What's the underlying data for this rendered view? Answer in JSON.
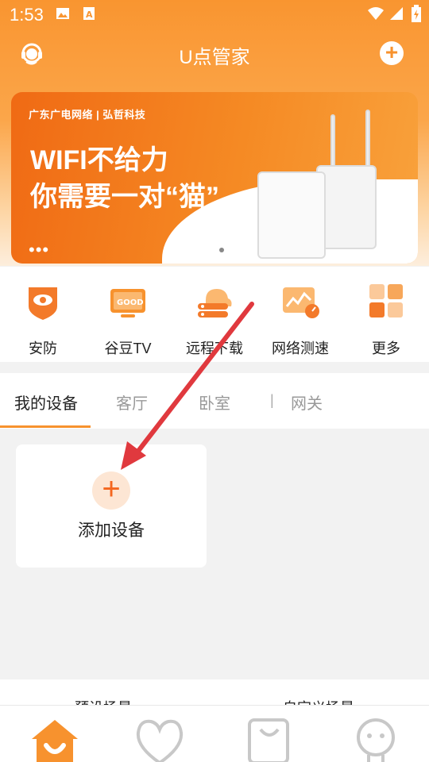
{
  "status": {
    "time": "1:53"
  },
  "header": {
    "title": "U点管家"
  },
  "banner": {
    "brand": "广东广电网络 | 弘哲科技",
    "headline1": "WIFI不给力",
    "headline2": "你需要一对“猫”",
    "dots": "•••"
  },
  "quick": [
    {
      "label": "安防"
    },
    {
      "label": "谷豆TV"
    },
    {
      "label": "远程下载"
    },
    {
      "label": "网络测速"
    },
    {
      "label": "更多"
    }
  ],
  "tabs": [
    {
      "label": "我的设备"
    },
    {
      "label": "客厅"
    },
    {
      "label": "卧室"
    },
    {
      "label": "网关"
    }
  ],
  "tab_separator": "|",
  "add_device": {
    "label": "添加设备",
    "plus": "+"
  },
  "scenes": {
    "left": "预设场景",
    "right": "自定义场景"
  },
  "colors": {
    "accent": "#f7922e",
    "accent_dark": "#f4661e",
    "annotation": "#e0393e"
  }
}
